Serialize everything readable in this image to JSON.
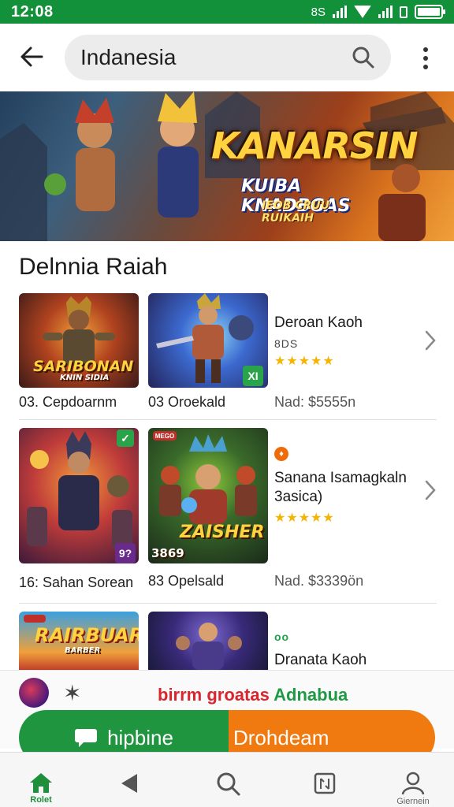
{
  "status_bar": {
    "time": "12:08",
    "network_label": "8S"
  },
  "top_bar": {
    "search_value": "Indanesia"
  },
  "banner": {
    "title": "KANARSIN",
    "subtitle": "KUIBA KNADBGAS",
    "tagline": "IEOB CRUU RUIKAIH"
  },
  "section": {
    "title": "Delnnia Raiah"
  },
  "rows": [
    {
      "tile_left_caption": "03. Cepdoarnm",
      "tile_left_art_text": "SARIBONAN",
      "tile_left_art_sub": "KNIN SIDIA",
      "tile_right_caption": "03 Oroekald",
      "tile_right_badge": "XI",
      "name": "Deroan Kaoh",
      "meta": "8DS",
      "stars": "★★★★★",
      "price": "Nad: $5555n"
    },
    {
      "tile_left_caption": "16: Sahan Sorean",
      "tile_left_badge": "9?",
      "tile_right_caption": "83 Opelsald",
      "tile_right_art_text": "ZAISHER",
      "tile_right_art_num": "3869",
      "tile_right_badge": "MEGO",
      "dot_label": "♦",
      "name": "Sanana Isamagkaln 3asica)",
      "stars": "★★★★★",
      "price": "Nad. $3339ön"
    },
    {
      "tile_left_art_text": "RAIRBUAR",
      "tile_left_art_sub": "BARBER",
      "oo_label": "oo",
      "name": "Dranata Kaoh"
    }
  ],
  "promo": {
    "text_red": "birrm groatas",
    "text_green": "Adnabua",
    "cta_left": "hipbine",
    "cta_right": "Drohdeam"
  },
  "bottom_nav": {
    "items": [
      {
        "label": "Rolet",
        "icon": "home-icon"
      },
      {
        "label": "",
        "icon": "back-triangle-icon"
      },
      {
        "label": "",
        "icon": "search-icon"
      },
      {
        "label": "",
        "icon": "apps-icon"
      },
      {
        "label": "Giernein",
        "icon": "profile-icon"
      }
    ]
  },
  "colors": {
    "status_bar": "#12903a",
    "cta_green": "#20953f",
    "cta_orange": "#f07a10",
    "star": "#f4b400"
  }
}
